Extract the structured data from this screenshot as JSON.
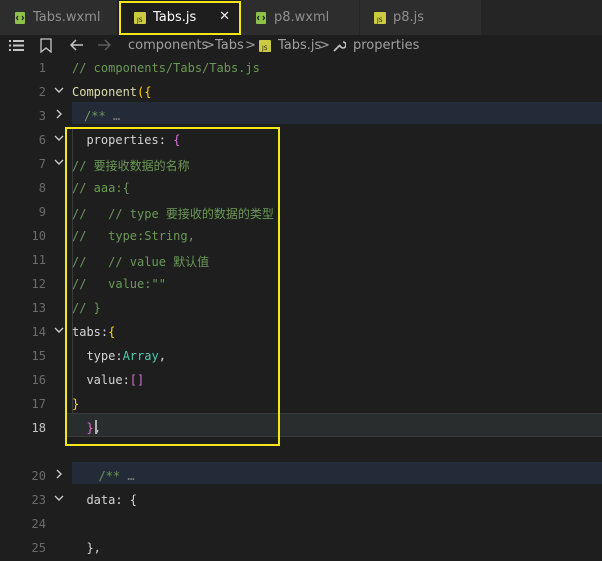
{
  "tabs": [
    {
      "label": "Tabs.wxml",
      "kind": "wxml",
      "active": false
    },
    {
      "label": "Tabs.js",
      "kind": "js",
      "active": true,
      "close": "✕"
    },
    {
      "label": "p8.wxml",
      "kind": "wxml",
      "active": false
    },
    {
      "label": "p8.js",
      "kind": "js",
      "active": false
    }
  ],
  "breadcrumb": {
    "seg1": "components",
    "sep": ">",
    "seg2": "Tabs",
    "seg3": "Tabs.js",
    "seg4": "properties"
  },
  "lines": [
    {
      "n": "1",
      "parts": [
        [
          "c-com",
          "// components/Tabs/Tabs.js"
        ]
      ]
    },
    {
      "n": "2",
      "fold": "open",
      "parts": [
        [
          "c-fn",
          "Component"
        ],
        [
          "c-brk",
          "({"
        ]
      ]
    },
    {
      "n": "3",
      "fold": "closed",
      "indent": true,
      "parts": [
        [
          "c-com",
          "/** "
        ],
        [
          "c-ell",
          "…"
        ]
      ]
    },
    {
      "n": "6",
      "fold": "open",
      "parts": [
        [
          "c-plain",
          "  properties: "
        ],
        [
          "c-brk2",
          "{"
        ]
      ]
    },
    {
      "n": "7",
      "fold": "open",
      "parts": [
        [
          "c-com",
          "// 要接收数据的名称"
        ]
      ]
    },
    {
      "n": "8",
      "parts": [
        [
          "c-com",
          "// aaa:{"
        ]
      ]
    },
    {
      "n": "9",
      "parts": [
        [
          "c-com",
          "//   // type 要接收的数据的类型"
        ]
      ]
    },
    {
      "n": "10",
      "parts": [
        [
          "c-com",
          "//   type:String,"
        ]
      ]
    },
    {
      "n": "11",
      "parts": [
        [
          "c-com",
          "//   // value 默认值"
        ]
      ]
    },
    {
      "n": "12",
      "parts": [
        [
          "c-com",
          "//   value:\"\""
        ]
      ]
    },
    {
      "n": "13",
      "parts": [
        [
          "c-com",
          "// }"
        ]
      ]
    },
    {
      "n": "14",
      "fold": "open",
      "parts": [
        [
          "c-plain",
          "tabs:"
        ],
        [
          "c-brk",
          "{"
        ]
      ]
    },
    {
      "n": "15",
      "parts": [
        [
          "c-plain",
          "  type:"
        ],
        [
          "c-type",
          "Array"
        ],
        [
          "c-plain",
          ","
        ]
      ]
    },
    {
      "n": "16",
      "parts": [
        [
          "c-plain",
          "  value:"
        ],
        [
          "c-brk2",
          "[]"
        ]
      ]
    },
    {
      "n": "17",
      "parts": [
        [
          "c-brk",
          "}"
        ]
      ]
    },
    {
      "n": "18",
      "current": true,
      "parts": [
        [
          "c-plain",
          "  "
        ],
        [
          "c-brk2",
          "}"
        ],
        [
          "c-plain",
          ","
        ]
      ]
    },
    {
      "n": "",
      "parts": []
    },
    {
      "n": "20",
      "fold": "closed",
      "indent": true,
      "parts": [
        [
          "c-com",
          "  /** "
        ],
        [
          "c-ell",
          "…"
        ]
      ]
    },
    {
      "n": "23",
      "fold": "open",
      "parts": [
        [
          "c-plain",
          "  data: {"
        ]
      ]
    },
    {
      "n": "24",
      "parts": []
    },
    {
      "n": "25",
      "parts": [
        [
          "c-plain",
          "  },"
        ]
      ]
    }
  ],
  "colors": {
    "highlight": "#f5e61a",
    "jsIcon": "#cbcb41",
    "wxmlIcon": "#8dc149"
  }
}
